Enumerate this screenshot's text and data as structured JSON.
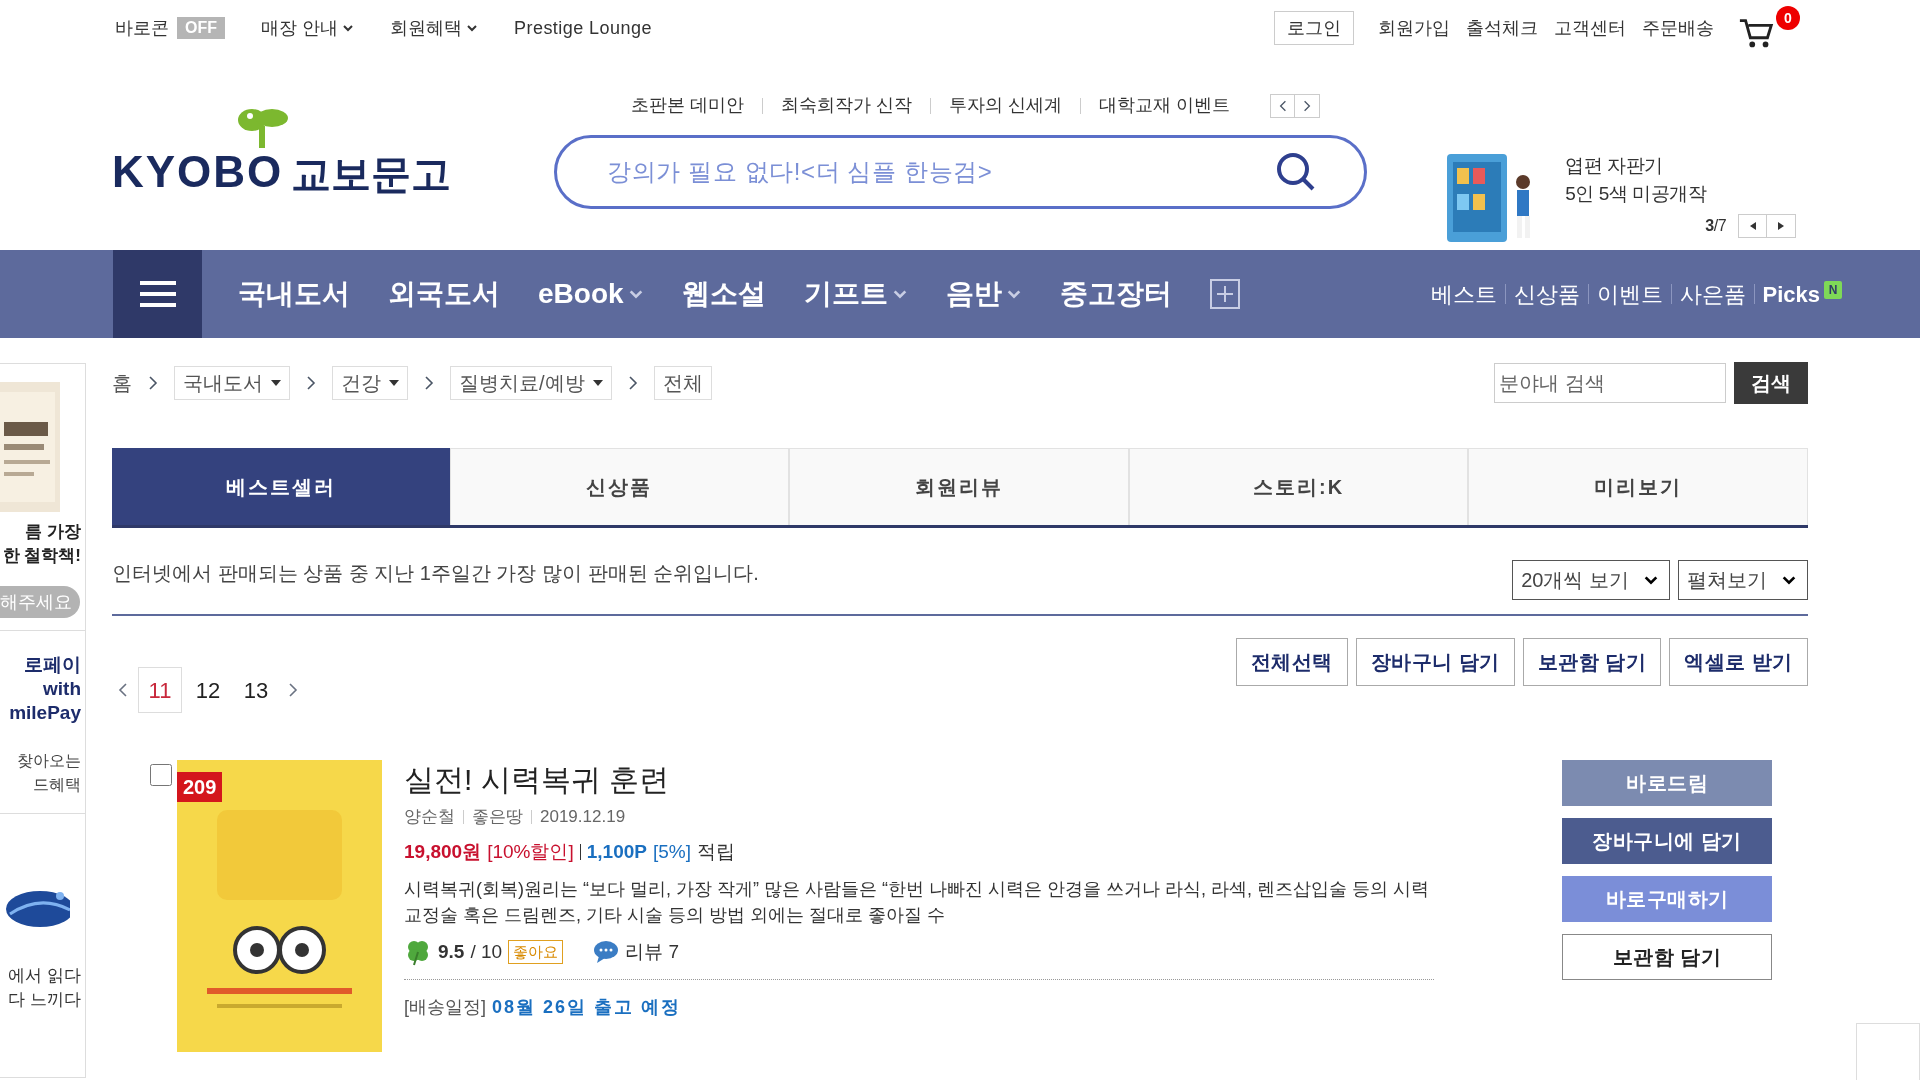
{
  "top_bar": {
    "left": [
      {
        "kind": "toggle",
        "label": "바로콘",
        "badge": "OFF",
        "on": false
      },
      {
        "kind": "dropdown",
        "label": "매장 안내"
      },
      {
        "kind": "dropdown",
        "label": "회원혜택"
      },
      {
        "kind": "link",
        "label": "Prestige Lounge"
      }
    ],
    "right": [
      {
        "kind": "boxed",
        "label": "로그인"
      },
      {
        "kind": "link",
        "label": "회원가입"
      },
      {
        "kind": "link",
        "label": "출석체크"
      },
      {
        "kind": "link",
        "label": "고객센터"
      },
      {
        "kind": "link",
        "label": "주문배송"
      }
    ],
    "cart_count": "0"
  },
  "logo": {
    "latin": "KYOBO",
    "korean": "교보문고"
  },
  "quick_links": [
    "초판본 데미안",
    "최숙희작가 신작",
    "투자의 신세계",
    "대학교재 이벤트"
  ],
  "search": {
    "placeholder": "강의가 필요 없다!<더 심플 한능검>"
  },
  "promo": {
    "lines": [
      "엽편 자판기",
      "5인 5색 미공개작"
    ],
    "current": "3",
    "total": "/7"
  },
  "nav": {
    "items": [
      {
        "label": "국내도서",
        "dropdown": false
      },
      {
        "label": "외국도서",
        "dropdown": false
      },
      {
        "label": "eBook",
        "dropdown": true
      },
      {
        "label": "웹소설",
        "dropdown": false
      },
      {
        "label": "기프트",
        "dropdown": true
      },
      {
        "label": "음반",
        "dropdown": true
      },
      {
        "label": "중고장터",
        "dropdown": false
      }
    ],
    "right": [
      {
        "label": "베스트",
        "new": false
      },
      {
        "label": "신상품",
        "new": false
      },
      {
        "label": "이벤트",
        "new": false
      },
      {
        "label": "사은품",
        "new": false
      },
      {
        "label": "Picks",
        "new": true,
        "new_label": "N"
      }
    ]
  },
  "sidebar": {
    "texts": [
      [
        "름 가장",
        "한 철학책!"
      ],
      [
        "로페이",
        "with",
        "milePay"
      ],
      [
        "찾아오는",
        "드혜택"
      ],
      [
        "에서 읽다",
        "다 느끼다"
      ]
    ],
    "pill": "해주세요"
  },
  "breadcrumb": {
    "home": "홈",
    "items": [
      {
        "label": "국내도서",
        "dropdown": true
      },
      {
        "label": "건강",
        "dropdown": true
      },
      {
        "label": "질병치료/예방",
        "dropdown": true
      },
      {
        "label": "전체",
        "dropdown": false
      }
    ]
  },
  "category_search": {
    "placeholder": "분야내 검색",
    "button": "검색"
  },
  "tabs": [
    {
      "label": "베스트셀러",
      "selected": true
    },
    {
      "label": "신상품",
      "selected": false
    },
    {
      "label": "회원리뷰",
      "selected": false
    },
    {
      "label": "스토리:K",
      "selected": false
    },
    {
      "label": "미리보기",
      "selected": false
    }
  ],
  "description": "인터넷에서 판매되는 상품 중 지난 1주일간 가장 많이 판매된 순위입니다.",
  "selects": [
    "20개씩 보기",
    "펼쳐보기"
  ],
  "actions": [
    "전체선택",
    "장바구니 담기",
    "보관함 담기",
    "엑셀로 받기"
  ],
  "pages": [
    {
      "label": "11",
      "selected": true
    },
    {
      "label": "12",
      "selected": false
    },
    {
      "label": "13",
      "selected": false
    }
  ],
  "product": {
    "checked": false,
    "rank": "209",
    "title": "실전! 시력복귀 훈련",
    "author": "양순철",
    "publisher": "좋은땅",
    "date": "2019.12.19",
    "price": "19,800원",
    "discount": "[10%할인]",
    "points": "1,100P",
    "points_rate": "[5%]",
    "points_suffix": "적립",
    "summary": "시력복귀(회복)원리는 “보다 멀리, 가장 작게” 많은 사람들은 “한번 나빠진 시력은 안경을 쓰거나 라식, 라섹, 렌즈삽입술 등의 시력교정술 혹은 드림렌즈, 기타 시술 등의 방법 외에는 절대로 좋아질 수",
    "rating": "9.5",
    "rating_max": "/ 10",
    "rating_badge": "좋아요",
    "review": "리뷰 7",
    "delivery_label": "[배송일정]",
    "delivery": "08월 26일 출고 예정",
    "buttons": [
      {
        "kind": "muted",
        "label": "바로드림"
      },
      {
        "kind": "primary",
        "label": "장바구니에 담기"
      },
      {
        "kind": "light",
        "label": "바로구매하기"
      },
      {
        "kind": "outline",
        "label": "보관함 담기"
      }
    ]
  }
}
